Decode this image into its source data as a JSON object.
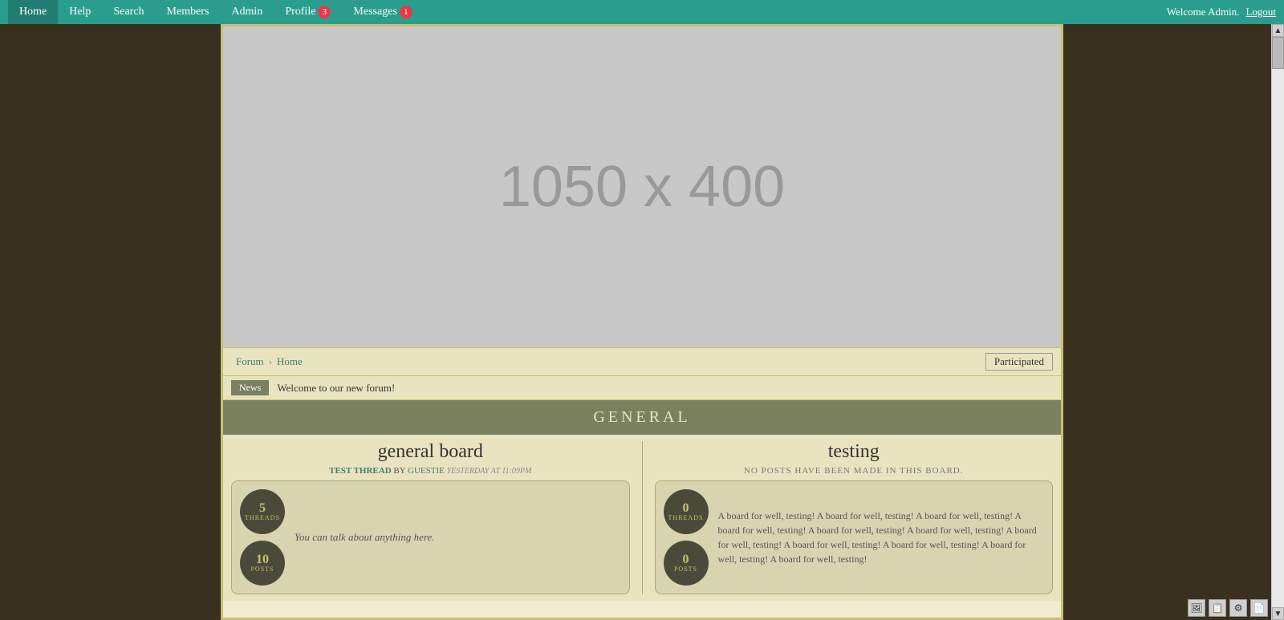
{
  "nav": {
    "items": [
      {
        "label": "Home",
        "active": true,
        "badge": null
      },
      {
        "label": "Help",
        "active": false,
        "badge": null
      },
      {
        "label": "Search",
        "active": false,
        "badge": null
      },
      {
        "label": "Members",
        "active": false,
        "badge": null
      },
      {
        "label": "Admin",
        "active": false,
        "badge": null
      },
      {
        "label": "Profile",
        "active": false,
        "badge": "3"
      },
      {
        "label": "Messages",
        "active": false,
        "badge": "1"
      }
    ],
    "welcome_text": "Welcome Admin.",
    "logout_label": "Logout"
  },
  "banner": {
    "size_label": "1050 x 400"
  },
  "breadcrumb": {
    "items": [
      "Forum",
      "Home"
    ],
    "participated_label": "Participated"
  },
  "news": {
    "label": "News",
    "text": "Welcome to our new forum!"
  },
  "sections": [
    {
      "title": "GENERAL",
      "boards": [
        {
          "title": "general board",
          "last_post": {
            "thread": "TEST THREAD",
            "by": "BY",
            "user": "GUESTIE",
            "time": "YESTERDAY AT 11:09PM"
          },
          "no_posts": false,
          "stats": [
            {
              "value": "5",
              "label": "THREADS"
            },
            {
              "value": "10",
              "label": "POSTS"
            }
          ],
          "description": "You can talk about anything here.",
          "description_long": false
        },
        {
          "title": "testing",
          "last_post": null,
          "no_posts": true,
          "no_posts_text": "NO POSTS HAVE BEEN MADE IN THIS BOARD.",
          "stats": [
            {
              "value": "0",
              "label": "THREADS"
            },
            {
              "value": "0",
              "label": "POSTS"
            }
          ],
          "description": "",
          "description_long": "A board for well, testing! A board for well, testing! A board for well, testing! A board for well, testing! A board for well, testing! A board for well, testing! A board for well, testing! A board for well, testing! A board for well, testing! A board for well, testing! A board for well, testing!"
        }
      ]
    }
  ]
}
